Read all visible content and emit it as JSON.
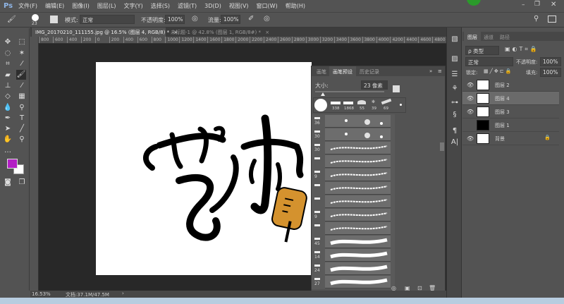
{
  "menubar": {
    "logo": "Ps",
    "items": [
      "文件(F)",
      "编辑(E)",
      "图像(I)",
      "图层(L)",
      "文字(Y)",
      "选择(S)",
      "滤镜(T)",
      "3D(D)",
      "视图(V)",
      "窗口(W)",
      "帮助(H)"
    ]
  },
  "options": {
    "brush_size": "23",
    "mode_label": "模式:",
    "mode_value": "正常",
    "opacity_label": "不透明度:",
    "opacity_value": "100%",
    "flow_label": "流量:",
    "flow_value": "100%"
  },
  "doc_tabs": [
    {
      "label": "IMG_20170210_111155.jpg @ 16.5% (图层 4, RGB/8) *",
      "close": "×"
    },
    {
      "label": "未标题-1 @ 42.8% (图层 1, RGB/8#) *",
      "close": "×"
    }
  ],
  "ruler": [
    "800",
    "600",
    "400",
    "200",
    "0",
    "200",
    "400",
    "600",
    "800",
    "1000",
    "1200",
    "1400",
    "1600",
    "1800",
    "2000",
    "2200",
    "2400",
    "2600",
    "2800",
    "3000",
    "3200",
    "3400",
    "3600",
    "3800",
    "4000",
    "4200",
    "4400",
    "4600",
    "4800"
  ],
  "status": {
    "zoom": "16.53%",
    "doc": "文档:37.1M/47.5M"
  },
  "colors": {
    "foreground": "#b31fc4",
    "background": "#ffffff",
    "brush_handle": "#d4922e"
  },
  "brush_panel": {
    "tabs": [
      "画笔",
      "画笔预设",
      "历史记录"
    ],
    "size_label": "大小:",
    "size_value": "23 像素",
    "presets": [
      "338",
      "1868",
      "55",
      "39",
      "69"
    ],
    "items": [
      "36",
      "30",
      "30",
      "",
      "9",
      "",
      "",
      "9",
      "",
      "45",
      "14",
      "24",
      "27"
    ]
  },
  "layers_panel": {
    "tabs": [
      "图层",
      "通道",
      "路径"
    ],
    "filter": "ρ 类型",
    "blend": "正常",
    "opacity_label": "不透明度:",
    "opacity_value": "100%",
    "lock_label": "锁定:",
    "fill_label": "填充:",
    "fill_value": "100%",
    "layers": [
      {
        "name": "图层 2",
        "visible": true
      },
      {
        "name": "图层 4",
        "visible": true,
        "selected": true
      },
      {
        "name": "图层 3",
        "visible": true
      },
      {
        "name": "图层 1",
        "visible": false
      },
      {
        "name": "背景",
        "visible": true,
        "locked": true
      }
    ]
  }
}
